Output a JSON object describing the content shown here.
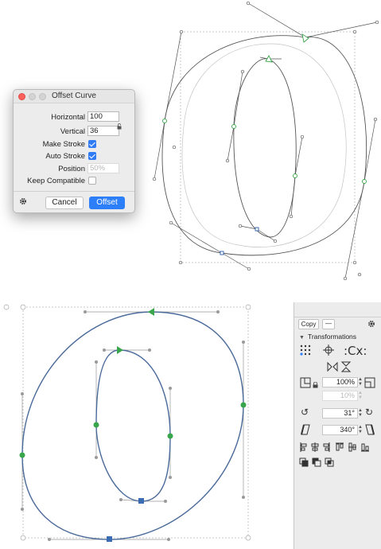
{
  "dialog": {
    "title": "Offset Curve",
    "horizontal_label": "Horizontal",
    "horizontal_value": "100",
    "vertical_label": "Vertical",
    "vertical_value": "36",
    "make_stroke_label": "Make Stroke",
    "make_stroke_checked": true,
    "auto_stroke_label": "Auto Stroke",
    "auto_stroke_checked": true,
    "position_label": "Position",
    "position_placeholder": "50%",
    "keep_compatible_label": "Keep Compatible",
    "keep_compatible_checked": false,
    "cancel_label": "Cancel",
    "offset_label": "Offset"
  },
  "palette": {
    "copy_label": "Copy",
    "dash_label": "—",
    "section_title": "Transformations",
    "scale_value": "100%",
    "scale_secondary_placeholder": "10%",
    "rotate_value": "31°",
    "slant_value": "340°"
  },
  "colors": {
    "node_green": "#3aa64c",
    "node_blue": "#3b6db5",
    "path_blue": "#4a6a9a",
    "accent": "#2d7ff9"
  },
  "icons": [
    "gear-icon",
    "lock-icon",
    "rotate-left-icon",
    "rotate-right-icon",
    "mirror-icon",
    "scale-icon",
    "slant-icon",
    "align-icon",
    "boolean-icon"
  ]
}
